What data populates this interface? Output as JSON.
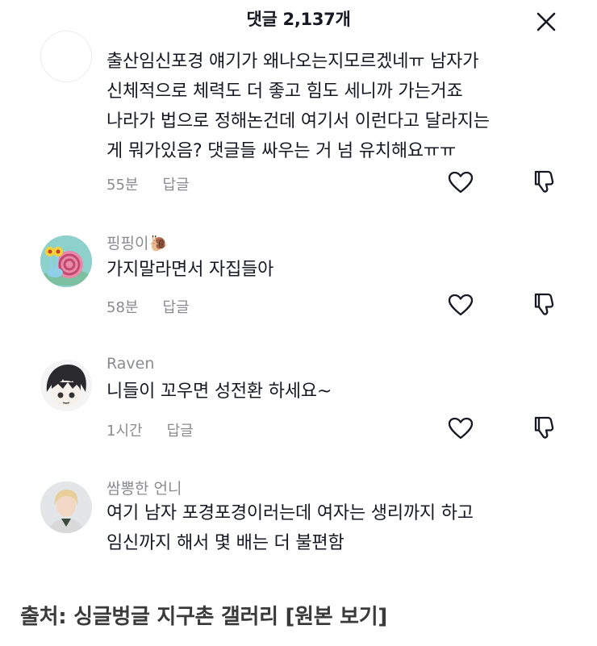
{
  "header": {
    "title": "댓글 2,137개"
  },
  "comments": [
    {
      "username": "",
      "lines": [
        "출산임신포경 얘기가 왜나오는지모르겠네ㅠ 남자가",
        "신체적으로 체력도 더 좋고 힘도 세니까 가는거죠",
        "나라가 법으로 정해논건데 여기서 이런다고 달라지는",
        "게 뭐가있음? 댓글들 싸우는 거 넘 유치해요ㅠㅠ"
      ],
      "time": "55분",
      "reply_label": "답글"
    },
    {
      "username": "핑핑이🐌",
      "lines": [
        "가지말라면서 자집들아"
      ],
      "time": "58분",
      "reply_label": "답글"
    },
    {
      "username": "Raven",
      "lines": [
        "니들이 꼬우면 성전환 하세요~"
      ],
      "time": "1시간",
      "reply_label": "답글"
    },
    {
      "username": "쌈뽕한 언니",
      "lines": [
        "여기 남자 포경포경이러는데 여자는 생리까지 하고",
        "임신까지 해서 몇 배는 더 불편함"
      ]
    }
  ],
  "source": {
    "prefix": "출처: 싱글벙글 지구촌 갤러리 ",
    "link_label": "[원본 보기]"
  },
  "icons": {
    "close": "close-icon",
    "like": "heart-outline-icon",
    "dislike": "thumbs-down-outline-icon"
  }
}
